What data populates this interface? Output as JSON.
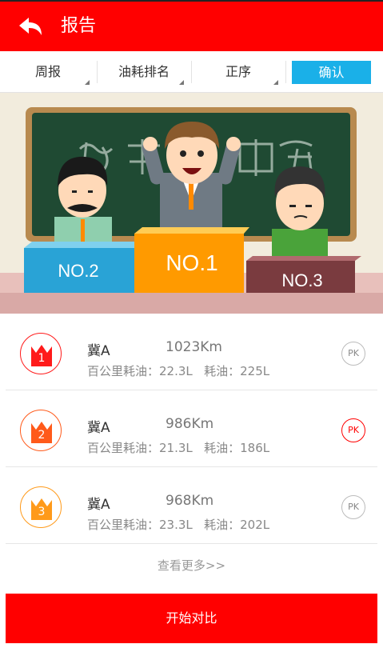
{
  "header": {
    "title": "报告",
    "back_icon": "back-arrow-icon"
  },
  "filters": {
    "period": "周报",
    "metric": "油耗排名",
    "order": "正序",
    "confirm": "确认"
  },
  "banner": {
    "podium": [
      {
        "label": "NO.2",
        "color": "#29a3d6"
      },
      {
        "label": "NO.1",
        "color": "#ff9a00"
      },
      {
        "label": "NO.3",
        "color": "#7a3b3f"
      }
    ]
  },
  "ranking": [
    {
      "rank": "1",
      "plate": "冀A",
      "distance": "1023Km",
      "per100_label": "百公里耗油：",
      "per100": "22.3L",
      "total_label": "耗油：",
      "total": "225L",
      "pk": "PK",
      "color": "#ff1a1a",
      "pk_active": false
    },
    {
      "rank": "2",
      "plate": "冀A",
      "distance": "986Km",
      "per100_label": "百公里耗油：",
      "per100": "21.3L",
      "total_label": "耗油：",
      "total": "186L",
      "pk": "PK",
      "color": "#ff5a1a",
      "pk_active": true
    },
    {
      "rank": "3",
      "plate": "冀A",
      "distance": "968Km",
      "per100_label": "百公里耗油：",
      "per100": "23.3L",
      "total_label": "耗油：",
      "total": "202L",
      "pk": "PK",
      "color": "#ff9a1a",
      "pk_active": false
    }
  ],
  "more": "查看更多>>",
  "start_button": "开始对比"
}
